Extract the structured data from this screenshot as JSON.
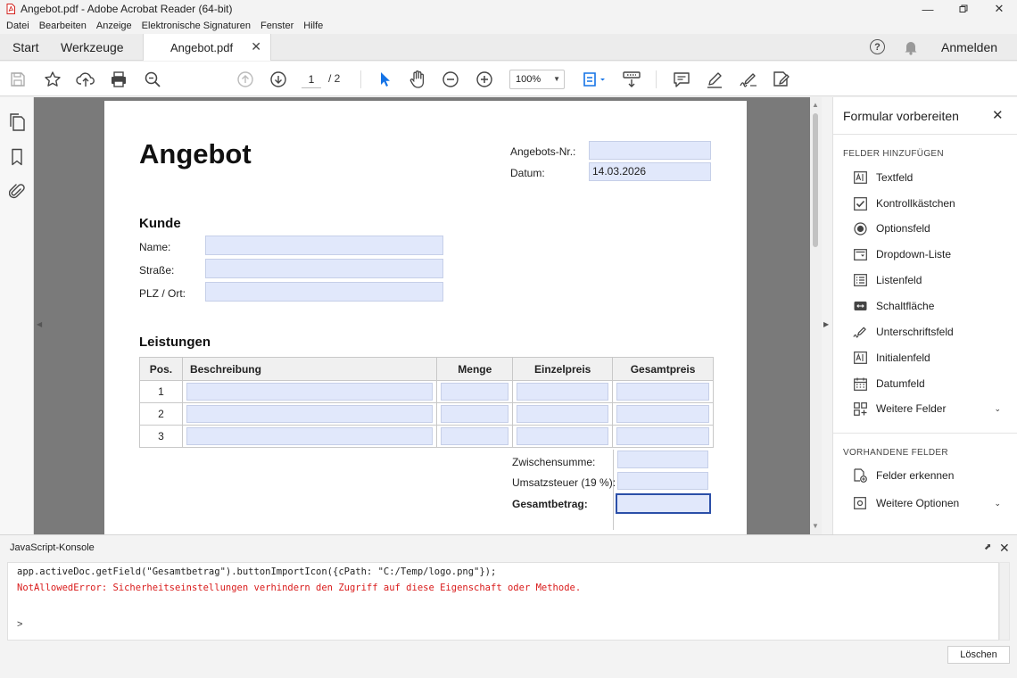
{
  "window": {
    "title": "Angebot.pdf - Adobe Acrobat Reader (64-bit)",
    "controls": [
      "minimize-icon",
      "maximize-icon",
      "close-icon"
    ]
  },
  "menu": [
    "Datei",
    "Bearbeiten",
    "Anzeige",
    "Elektronische Signaturen",
    "Fenster",
    "Hilfe"
  ],
  "tabs": {
    "start": "Start",
    "tools": "Werkzeuge",
    "document": "Angebot.pdf",
    "sign_in": "Anmelden",
    "help": "?"
  },
  "toolbar": {
    "page_current": "1",
    "page_total": "/ 2",
    "zoom": "100%",
    "icons": [
      "save-icon",
      "star-icon",
      "upload-cloud-icon",
      "print-icon",
      "search-zoom-icon",
      "prev-page-icon",
      "next-page-icon",
      "select-cursor-icon",
      "hand-icon",
      "zoom-out-icon",
      "zoom-in-icon",
      "fit-page-icon",
      "scroll-mode-icon",
      "comment-icon",
      "highlight-pen-icon",
      "sign-icon",
      "fill-sign-icon"
    ],
    "accent": "#1473e6"
  },
  "left_rail": [
    "pages-icon",
    "bookmark-icon",
    "attachment-icon"
  ],
  "document": {
    "title": "Angebot",
    "offer_no_label": "Angebots-Nr.:",
    "offer_no_value": "",
    "date_label": "Datum:",
    "date_value": "14.03.2026",
    "customer_heading": "Kunde",
    "name_label": "Name:",
    "street_label": "Straße:",
    "city_label": "PLZ / Ort:",
    "services_heading": "Leistungen",
    "table": {
      "headers": [
        "Pos.",
        "Beschreibung",
        "Menge",
        "Einzelpreis",
        "Gesamtpreis"
      ],
      "rows": [
        "1",
        "2",
        "3"
      ]
    },
    "subtotal_label": "Zwischensumme:",
    "vat_label": "Umsatzsteuer (19 %):",
    "total_label": "Gesamtbetrag:",
    "field_color": "#e1e8fb"
  },
  "right_panel": {
    "title": "Formular vorbereiten",
    "add_fields_heading": "FELDER HINZUFÜGEN",
    "add_fields": [
      {
        "label": "Textfeld",
        "icon": "text-field-icon"
      },
      {
        "label": "Kontrollkästchen",
        "icon": "checkbox-icon"
      },
      {
        "label": "Optionsfeld",
        "icon": "radio-button-icon"
      },
      {
        "label": "Dropdown-Liste",
        "icon": "dropdown-icon"
      },
      {
        "label": "Listenfeld",
        "icon": "list-box-icon"
      },
      {
        "label": "Schaltfläche",
        "icon": "button-icon"
      },
      {
        "label": "Unterschriftsfeld",
        "icon": "signature-icon"
      },
      {
        "label": "Initialenfeld",
        "icon": "initials-icon"
      },
      {
        "label": "Datumfeld",
        "icon": "calendar-icon"
      },
      {
        "label": "Weitere Felder",
        "icon": "more-fields-icon"
      }
    ],
    "existing_heading": "VORHANDENE FELDER",
    "existing": [
      {
        "label": "Felder erkennen",
        "icon": "detect-fields-icon"
      },
      {
        "label": "Weitere Optionen",
        "icon": "more-options-icon"
      }
    ]
  },
  "console": {
    "title": "JavaScript-Konsole",
    "command": "app.activeDoc.getField(\"Gesamtbetrag\").buttonImportIcon({cPath: \"C:/Temp/logo.png\"});",
    "error": "NotAllowedError: Sicherheitseinstellungen verhindern den Zugriff auf diese Eigenschaft oder Methode.",
    "prompt": ">",
    "clear_button": "Löschen",
    "error_color": "#d91a1a"
  }
}
